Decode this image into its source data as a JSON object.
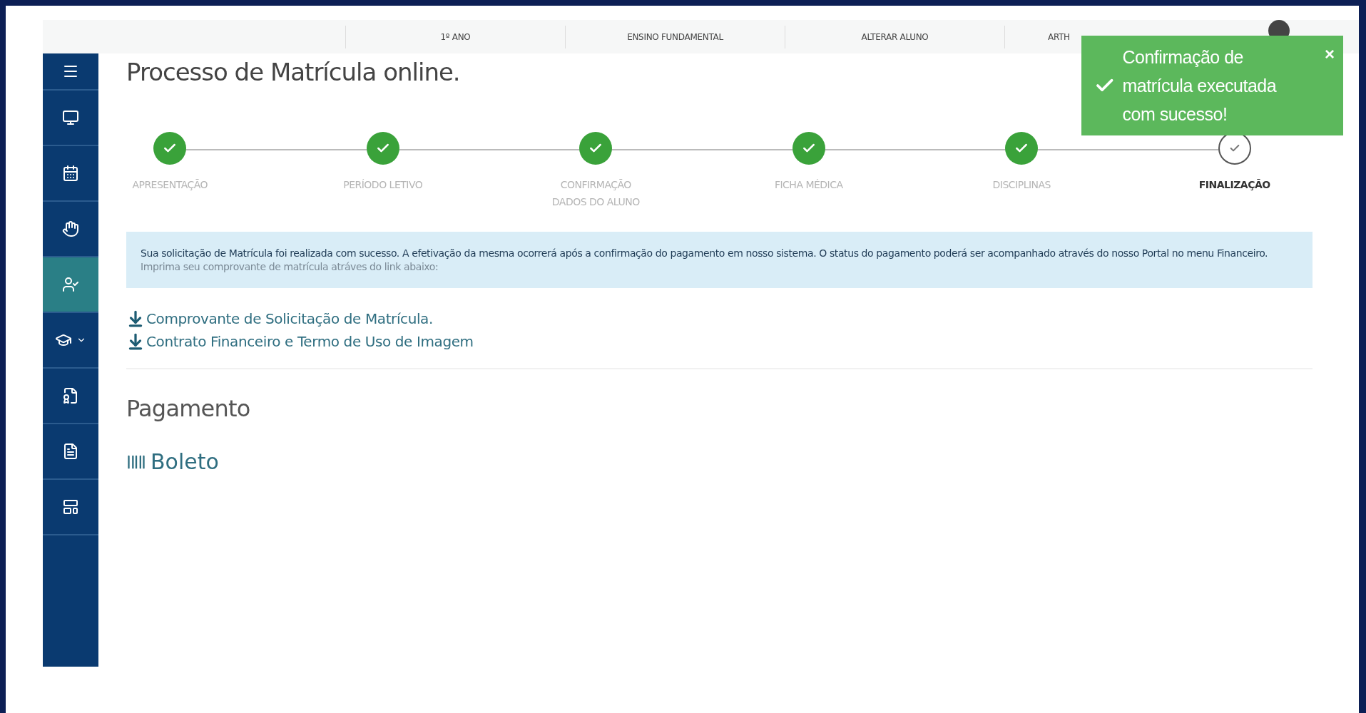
{
  "top_bar": {
    "items": [
      "1º ANO",
      "ENSINO FUNDAMENTAL",
      "ALTERAR ALUNO",
      "ARTH"
    ]
  },
  "sidebar": {
    "items": [
      {
        "selected": false
      },
      {
        "selected": false
      },
      {
        "selected": false
      },
      {
        "selected": false
      },
      {
        "selected": true
      },
      {
        "selected": false
      },
      {
        "selected": false
      },
      {
        "selected": false
      },
      {
        "selected": false
      }
    ]
  },
  "page_title": "Processo de Matrícula online.",
  "steps": [
    {
      "label": "APRESENTAÇÃO",
      "completed": true,
      "selected": false
    },
    {
      "label": "PERÍODO LETIVO",
      "completed": true,
      "selected": false
    },
    {
      "label": "CONFIRMAÇÃO DADOS DO ALUNO",
      "completed": true,
      "selected": false
    },
    {
      "label": "FICHA MÉDICA",
      "completed": true,
      "selected": false
    },
    {
      "label": "DISCIPLINAS",
      "completed": true,
      "selected": false
    },
    {
      "label": "FINALIZAÇÃO",
      "completed": false,
      "selected": true
    }
  ],
  "notice": {
    "message": "Sua solicitação de Matrícula foi realizada com sucesso. A efetivação da mesma ocorrerá após a confirmação do pagamento em nosso sistema. O status do pagamento poderá ser acompanhado através do nosso Portal no menu Financeiro.",
    "hint": "Imprima seu comprovante de matrícula atráves do link abaixo:"
  },
  "downloads": [
    "Comprovante de Solicitação de Matrícula.",
    "Contrato Financeiro e Termo de Uso de Imagem"
  ],
  "payment": {
    "heading": "Pagamento",
    "methods": [
      "Boleto"
    ]
  },
  "toast": {
    "message": "Confirmação de matrícula executada com sucesso!",
    "close": "×"
  }
}
